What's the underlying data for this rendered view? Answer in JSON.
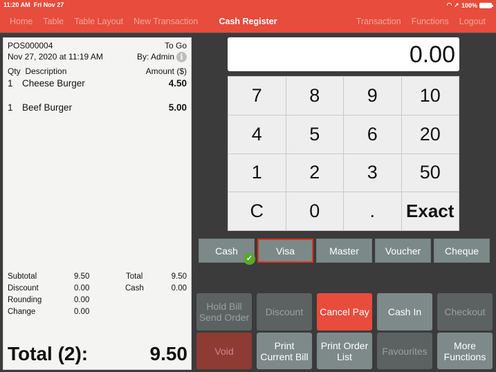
{
  "status_bar": {
    "time": "11:20 AM",
    "date": "Fri Nov 27",
    "battery": "100%"
  },
  "nav": {
    "left": [
      "Home",
      "Table",
      "Table Layout",
      "New Transaction"
    ],
    "title": "Cash Register",
    "right": [
      "Transaction",
      "Functions",
      "Logout"
    ]
  },
  "receipt": {
    "order_id": "POS000004",
    "order_type": "To Go",
    "datetime": "Nov 27, 2020 at 11:19 AM",
    "by": "By: Admin",
    "headers": {
      "qty": "Qty",
      "description": "Description",
      "amount": "Amount ($)"
    },
    "items": [
      {
        "qty": "1",
        "description": "Cheese Burger",
        "amount": "4.50"
      },
      {
        "qty": "1",
        "description": "Beef Burger",
        "amount": "5.00"
      }
    ],
    "summary": {
      "subtotal_label": "Subtotal",
      "subtotal": "9.50",
      "discount_label": "Discount",
      "discount": "0.00",
      "rounding_label": "Rounding",
      "rounding": "0.00",
      "change_label": "Change",
      "change": "0.00",
      "total_label": "Total",
      "total": "9.50",
      "cash_label": "Cash",
      "cash": "0.00"
    },
    "grand_total_label": "Total (2):",
    "grand_total": "9.50"
  },
  "display_value": "0.00",
  "keypad": [
    "7",
    "8",
    "9",
    "10",
    "4",
    "5",
    "6",
    "20",
    "1",
    "2",
    "3",
    "50",
    "C",
    "0",
    ".",
    "Exact"
  ],
  "tenders": [
    {
      "label": "Cash",
      "checked": true
    },
    {
      "label": "Visa",
      "selected": true
    },
    {
      "label": "Master"
    },
    {
      "label": "Voucher"
    },
    {
      "label": "Cheque"
    }
  ],
  "functions": [
    {
      "label": "Hold Bill\nSend Order",
      "state": "disabled"
    },
    {
      "label": "Discount",
      "state": "disabled"
    },
    {
      "label": "Cancel Pay",
      "state": "danger"
    },
    {
      "label": "Cash In",
      "state": "active"
    },
    {
      "label": "Checkout",
      "state": "disabled"
    },
    {
      "label": "Void",
      "state": "void"
    },
    {
      "label": "Print\nCurrent Bill",
      "state": "active"
    },
    {
      "label": "Print Order\nList",
      "state": "active"
    },
    {
      "label": "Favourites",
      "state": "disabled"
    },
    {
      "label": "More\nFunctions",
      "state": "active"
    }
  ],
  "colors": {
    "brand": "#e74c3c",
    "background": "#3b3b3b",
    "tender": "#7b8a89",
    "check": "#5aa82a"
  }
}
